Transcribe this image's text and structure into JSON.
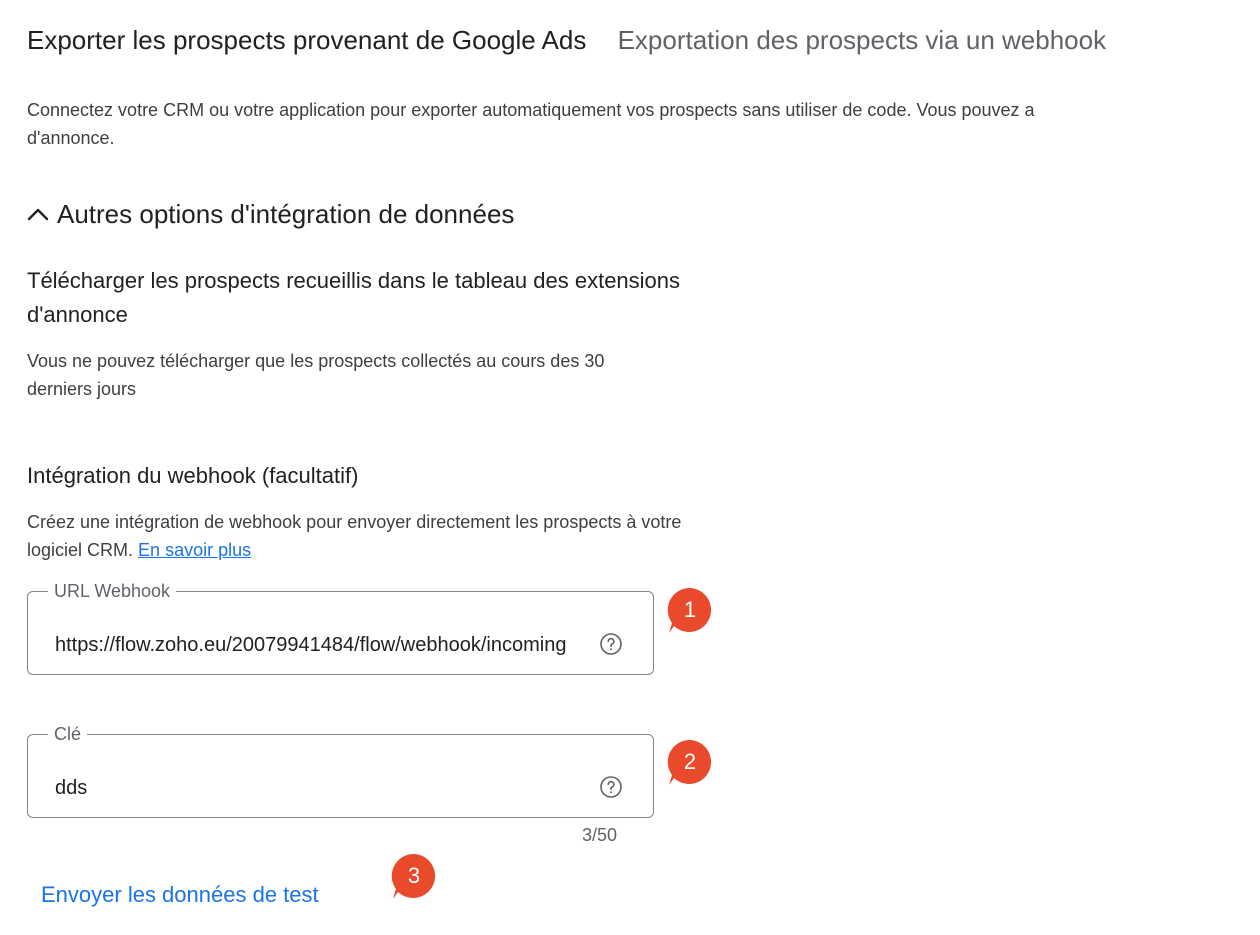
{
  "tabs": {
    "active": "Exporter les prospects provenant de Google Ads",
    "inactive": "Exportation des prospects via un webhook"
  },
  "intro": {
    "line1": "Connectez votre CRM ou votre application pour exporter automatiquement vos prospects sans utiliser de code. Vous pouvez a",
    "line2": "d'annonce."
  },
  "section": {
    "title": "Autres options d'intégration de données",
    "icon": "chevron-up-icon"
  },
  "download": {
    "heading": "Télécharger les prospects recueillis dans le tableau des extensions d'annonce",
    "description": "Vous ne pouvez télécharger que les prospects collectés au cours des 30 derniers jours"
  },
  "webhook": {
    "heading": "Intégration du webhook (facultatif)",
    "description": "Créez une intégration de webhook pour envoyer directement les prospects à votre logiciel CRM.",
    "learn_more": "En savoir plus",
    "url_field": {
      "label": "URL Webhook",
      "value": "https://flow.zoho.eu/20079941484/flow/webhook/incoming",
      "help_icon": "help-circle-icon"
    },
    "key_field": {
      "label": "Clé",
      "value": "dds",
      "counter": "3/50",
      "help_icon": "help-circle-icon"
    },
    "send_test": "Envoyer les données de test"
  },
  "annotations": [
    {
      "label": "1",
      "color": "#ea4a2c"
    },
    {
      "label": "2",
      "color": "#ea4a2c"
    },
    {
      "label": "3",
      "color": "#ea4a2c"
    }
  ]
}
